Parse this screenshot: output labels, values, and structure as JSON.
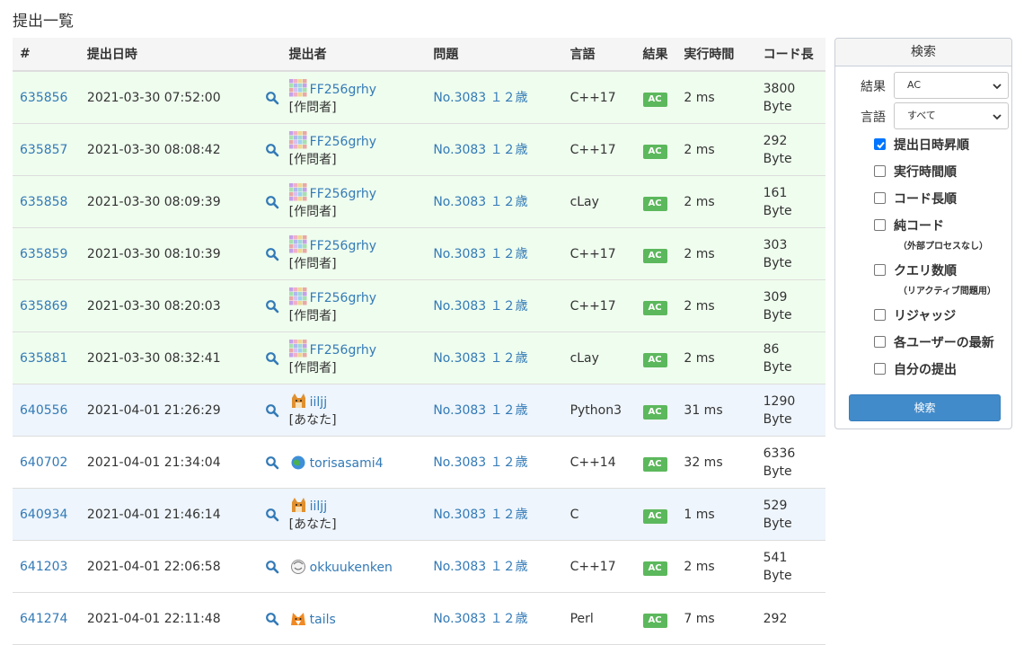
{
  "page": {
    "title": "提出一覧"
  },
  "table": {
    "headers": {
      "id": "#",
      "date": "提出日時",
      "user": "提出者",
      "problem": "問題",
      "language": "言語",
      "result": "結果",
      "time": "実行時間",
      "code_length": "コード長"
    },
    "rows": [
      {
        "id": "635856",
        "date": "2021-03-30 07:52:00",
        "user": "FF256grhy",
        "role": "[作問者]",
        "problem": "No.3083 １２歳",
        "language": "C++17",
        "result": "AC",
        "time": "2 ms",
        "length": "3800",
        "unit": "Byte",
        "kind": "author",
        "avatar": "pixel-avatar"
      },
      {
        "id": "635857",
        "date": "2021-03-30 08:08:42",
        "user": "FF256grhy",
        "role": "[作問者]",
        "problem": "No.3083 １２歳",
        "language": "C++17",
        "result": "AC",
        "time": "2 ms",
        "length": "292",
        "unit": "Byte",
        "kind": "author",
        "avatar": "pixel-avatar"
      },
      {
        "id": "635858",
        "date": "2021-03-30 08:09:39",
        "user": "FF256grhy",
        "role": "[作問者]",
        "problem": "No.3083 １２歳",
        "language": "cLay",
        "result": "AC",
        "time": "2 ms",
        "length": "161",
        "unit": "Byte",
        "kind": "author",
        "avatar": "pixel-avatar"
      },
      {
        "id": "635859",
        "date": "2021-03-30 08:10:39",
        "user": "FF256grhy",
        "role": "[作問者]",
        "problem": "No.3083 １２歳",
        "language": "C++17",
        "result": "AC",
        "time": "2 ms",
        "length": "303",
        "unit": "Byte",
        "kind": "author",
        "avatar": "pixel-avatar"
      },
      {
        "id": "635869",
        "date": "2021-03-30 08:20:03",
        "user": "FF256grhy",
        "role": "[作問者]",
        "problem": "No.3083 １２歳",
        "language": "C++17",
        "result": "AC",
        "time": "2 ms",
        "length": "309",
        "unit": "Byte",
        "kind": "author",
        "avatar": "pixel-avatar"
      },
      {
        "id": "635881",
        "date": "2021-03-30 08:32:41",
        "user": "FF256grhy",
        "role": "[作問者]",
        "problem": "No.3083 １２歳",
        "language": "cLay",
        "result": "AC",
        "time": "2 ms",
        "length": "86",
        "unit": "Byte",
        "kind": "author",
        "avatar": "pixel-avatar"
      },
      {
        "id": "640556",
        "date": "2021-04-01 21:26:29",
        "user": "iiljj",
        "role": "[あなた]",
        "problem": "No.3083 １２歳",
        "language": "Python3",
        "result": "AC",
        "time": "31 ms",
        "length": "1290",
        "unit": "Byte",
        "kind": "mine",
        "avatar": "shiba-avatar"
      },
      {
        "id": "640702",
        "date": "2021-04-01 21:34:04",
        "user": "torisasami4",
        "role": "",
        "problem": "No.3083 １２歳",
        "language": "C++14",
        "result": "AC",
        "time": "32 ms",
        "length": "6336",
        "unit": "Byte",
        "kind": "other",
        "avatar": "globe-avatar"
      },
      {
        "id": "640934",
        "date": "2021-04-01 21:46:14",
        "user": "iiljj",
        "role": "[あなた]",
        "problem": "No.3083 １２歳",
        "language": "C",
        "result": "AC",
        "time": "1 ms",
        "length": "529",
        "unit": "Byte",
        "kind": "mine",
        "avatar": "shiba-avatar"
      },
      {
        "id": "641203",
        "date": "2021-04-01 22:06:58",
        "user": "okkuukenken",
        "role": "",
        "problem": "No.3083 １２歳",
        "language": "C++17",
        "result": "AC",
        "time": "2 ms",
        "length": "541",
        "unit": "Byte",
        "kind": "other",
        "avatar": "sketch-avatar"
      },
      {
        "id": "641274",
        "date": "2021-04-01 22:11:48",
        "user": "tails",
        "role": "",
        "problem": "No.3083 １２歳",
        "language": "Perl",
        "result": "AC",
        "time": "7 ms",
        "length": "292",
        "unit": "",
        "kind": "other",
        "avatar": "fox-avatar"
      }
    ]
  },
  "search_panel": {
    "title": "検索",
    "result_label": "結果",
    "result_value": "AC",
    "language_label": "言語",
    "language_value": "すべて",
    "checkboxes": [
      {
        "label": "提出日時昇順",
        "checked": true,
        "note": ""
      },
      {
        "label": "実行時間順",
        "checked": false,
        "note": ""
      },
      {
        "label": "コード長順",
        "checked": false,
        "note": ""
      },
      {
        "label": "純コード",
        "checked": false,
        "note": "（外部プロセスなし）"
      },
      {
        "label": "クエリ数順",
        "checked": false,
        "note": "（リアクティブ問題用）"
      },
      {
        "label": "リジャッジ",
        "checked": false,
        "note": ""
      },
      {
        "label": "各ユーザーの最新",
        "checked": false,
        "note": ""
      },
      {
        "label": "自分の提出",
        "checked": false,
        "note": ""
      }
    ],
    "submit_label": "検索"
  },
  "colors": {
    "link": "#337ab7",
    "ac_badge": "#5cb85c",
    "author_row": "#effdee",
    "mine_row": "#eef5fc",
    "button": "#428bca",
    "checkbox_checked": "#0075ff"
  }
}
